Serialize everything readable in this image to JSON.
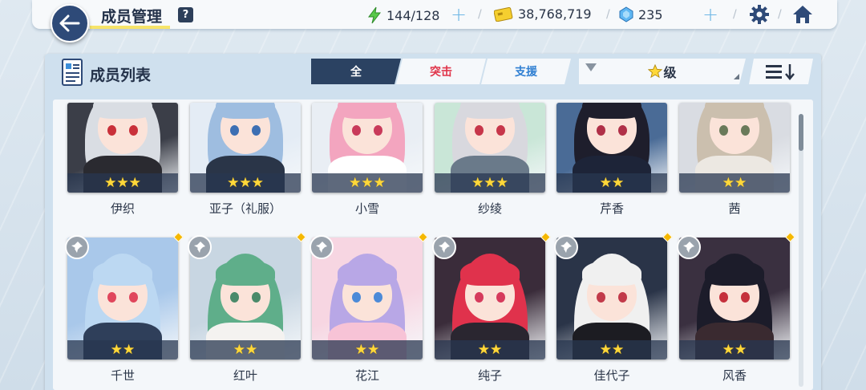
{
  "header": {
    "title": "成员管理",
    "help_label": "?",
    "stamina": "144/128",
    "credits": "38,768,719",
    "gems": "235"
  },
  "panel": {
    "title": "成员列表",
    "tabs": [
      {
        "label": "全",
        "active": true
      },
      {
        "label": "突击",
        "active": false
      },
      {
        "label": "支援",
        "active": false
      }
    ],
    "filter_label": "级",
    "filter_icon": "star-icon",
    "sort_icon": "sort-list-icon"
  },
  "colors": {
    "accent_dark": "#2b4262",
    "assault_red": "#e0344a",
    "support_blue": "#2f7fd2",
    "star_gold": "#ffd83a"
  },
  "rows": [
    {
      "members": [
        {
          "name": "伊织",
          "stars": 3
        },
        {
          "name": "亚子（礼服）",
          "stars": 3
        },
        {
          "name": "小雪",
          "stars": 3
        },
        {
          "name": "纱绫",
          "stars": 3
        },
        {
          "name": "芹香",
          "stars": 2
        },
        {
          "name": "茜",
          "stars": 2
        }
      ]
    },
    {
      "members": [
        {
          "name": "千世",
          "stars": 2
        },
        {
          "name": "红叶",
          "stars": 2
        },
        {
          "name": "花江",
          "stars": 2
        },
        {
          "name": "纯子",
          "stars": 2
        },
        {
          "name": "佳代子",
          "stars": 2
        },
        {
          "name": "风香",
          "stars": 2
        }
      ]
    }
  ],
  "star_glyphs": {
    "2": "★★",
    "3": "★★★"
  }
}
